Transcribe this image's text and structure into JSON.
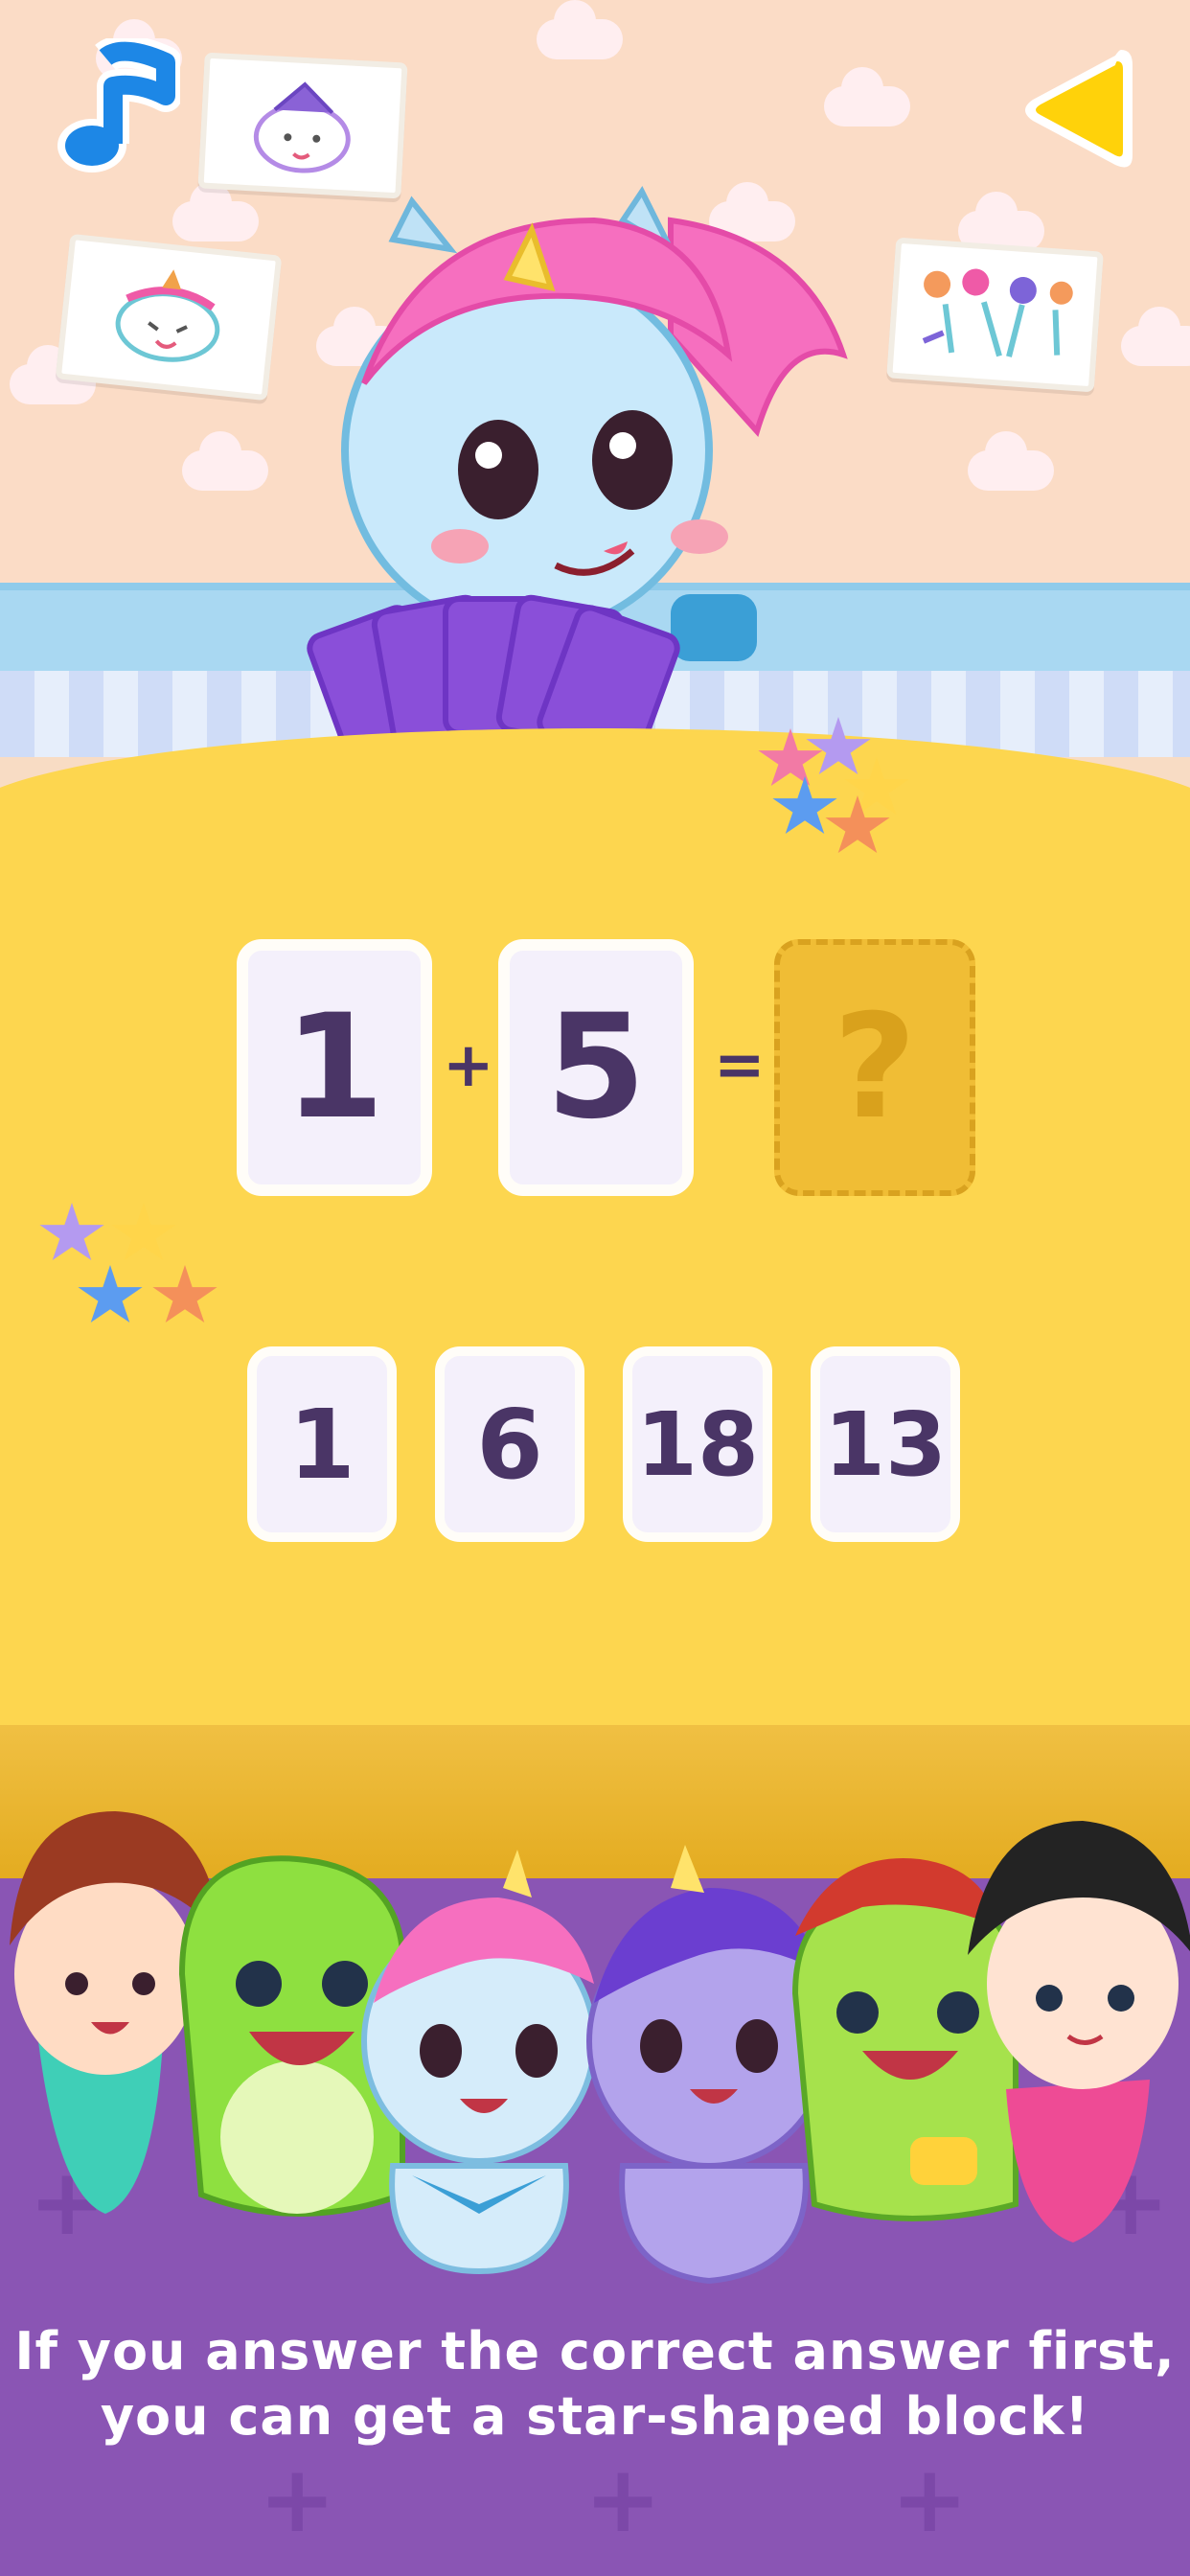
{
  "equation": {
    "operand_a": "1",
    "operator": "+",
    "operand_b": "5",
    "equals": "=",
    "unknown": "?"
  },
  "answer_choices": [
    "1",
    "6",
    "18",
    "13"
  ],
  "caption": {
    "line1": "If you answer the correct answer first,",
    "line2": "you can get a star-shaped block!"
  },
  "icons": {
    "music": "music-note-icon",
    "back": "back-arrow-icon"
  },
  "colors": {
    "table": "#fdd64f",
    "floor": "#8a55b4",
    "card_text": "#4a3566",
    "back_button": "#ffd20a",
    "music_button": "#1d87e6"
  }
}
